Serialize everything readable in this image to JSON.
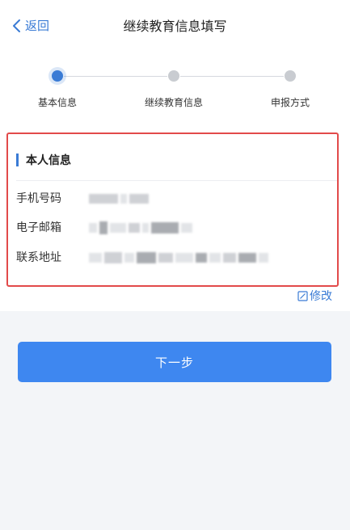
{
  "nav": {
    "back_label": "返回",
    "title": "继续教育信息填写"
  },
  "steps": [
    {
      "label": "基本信息",
      "state": "active"
    },
    {
      "label": "继续教育信息",
      "state": "pending"
    },
    {
      "label": "申报方式",
      "state": "pending"
    }
  ],
  "personal": {
    "section_title": "本人信息",
    "rows": [
      {
        "label": "手机号码",
        "value_state": "blurred"
      },
      {
        "label": "电子邮箱",
        "value_state": "blurred"
      },
      {
        "label": "联系地址",
        "value_state": "blurred"
      }
    ],
    "edit_label": "修改"
  },
  "next_button": {
    "label": "下一步"
  },
  "colors": {
    "accent": "#3a7bd5",
    "button": "#3e87f0",
    "highlight_border": "#e24a4a"
  }
}
